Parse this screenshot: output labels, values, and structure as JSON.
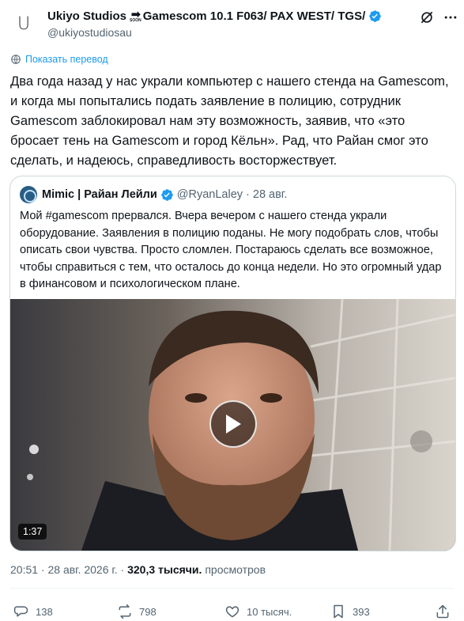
{
  "author": {
    "avatar_letter": "U",
    "name": "Ukiyo Studios",
    "soon_label": "SOON",
    "name_suffix": "Gamescom 10.1 F063/ PAX WEST/ TGS/",
    "handle": "@ukiyostudiosau",
    "verified": true
  },
  "translate_label": "Показать перевод",
  "tweet_text": "Два года назад у нас украли компьютер с нашего стенда на Gamescom, и когда мы попытались подать заявление в полицию, сотрудник Gamescom заблокировал нам эту возможность, заявив, что «это бросает тень на Gamescom и город Кёльн». Рад, что Райан смог это сделать, и надеюсь, справедливость восторжествует.",
  "quote": {
    "name": "Mimic | Райан Лейли",
    "handle": "@RyanLaley",
    "separator": "·",
    "date": "28 авг.",
    "text": "Мой #gamescom прервался. Вчера вечером с нашего стенда украли оборудование. Заявления в полицию поданы. Не могу подобрать слов, чтобы описать свои чувства. Просто сломлен. Постараюсь сделать все возможное, чтобы справиться с тем, что осталось до конца недели. Но это огромный удар в финансовом и психологическом плане.",
    "video_duration": "1:37"
  },
  "meta": {
    "time_date": "20:51 · 28 авг. 2026 г. · ",
    "views": "320,3 тысячи.",
    "views_label": "просмотров"
  },
  "actions": {
    "replies": "138",
    "reposts": "798",
    "likes": "10 тысяч.",
    "bookmarks": "393"
  },
  "colors": {
    "accent": "#1d9bf0",
    "text": "#0f1419",
    "secondary": "#536471",
    "border": "#cfd9de"
  }
}
